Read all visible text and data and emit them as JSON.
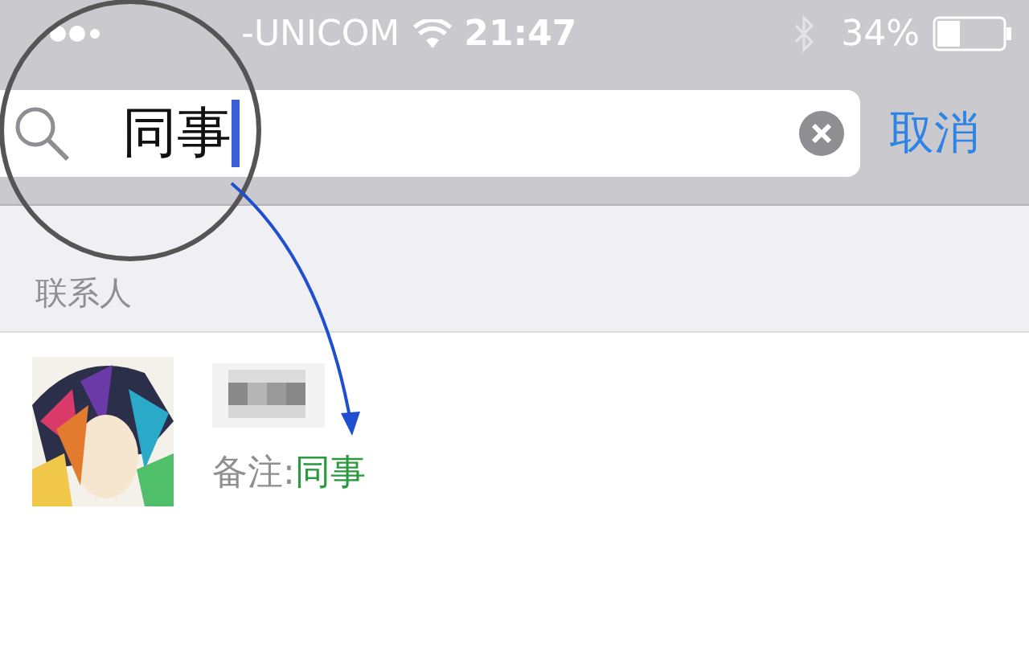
{
  "status_bar": {
    "carrier": "-UNICOM",
    "time": "21:47",
    "battery": "34%"
  },
  "search": {
    "value": "同事",
    "cancel": "取消"
  },
  "section": {
    "title": "联系人"
  },
  "contacts": [
    {
      "note_label": "备注:",
      "note_value": "同事"
    }
  ]
}
